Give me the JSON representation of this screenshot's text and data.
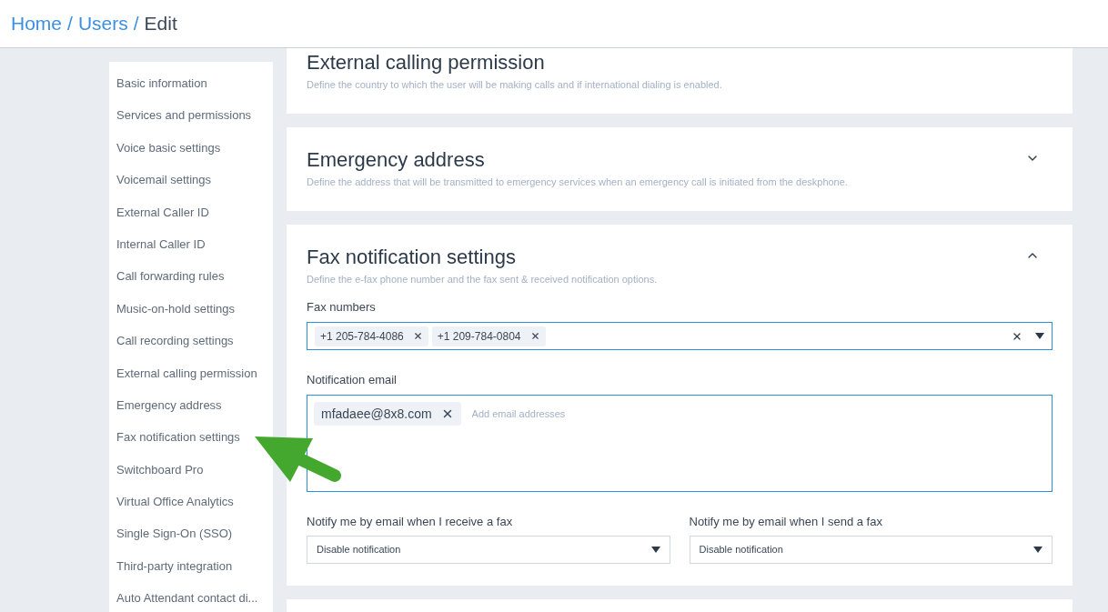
{
  "breadcrumb": [
    {
      "label": "Home",
      "kind": "link"
    },
    {
      "label": "/",
      "kind": "separator"
    },
    {
      "label": "Users",
      "kind": "link"
    },
    {
      "label": "/",
      "kind": "separator"
    },
    {
      "label": "Edit",
      "kind": "current"
    }
  ],
  "sidebar": {
    "items": [
      {
        "label": "Basic information"
      },
      {
        "label": "Services and permissions"
      },
      {
        "label": "Voice basic settings"
      },
      {
        "label": "Voicemail settings"
      },
      {
        "label": "External Caller ID"
      },
      {
        "label": "Internal Caller ID"
      },
      {
        "label": "Call forwarding rules"
      },
      {
        "label": "Music-on-hold settings"
      },
      {
        "label": "Call recording settings"
      },
      {
        "label": "External calling permission"
      },
      {
        "label": "Emergency address"
      },
      {
        "label": "Fax notification settings"
      },
      {
        "label": "Switchboard Pro"
      },
      {
        "label": "Virtual Office Analytics"
      },
      {
        "label": "Single Sign-On (SSO)"
      },
      {
        "label": "Third-party integration"
      },
      {
        "label": "Auto Attendant contact di..."
      }
    ]
  },
  "sections": [
    {
      "title": "External calling permission",
      "description": "Define the country to which the user will be making calls and if international dialing is enabled."
    },
    {
      "title": "Emergency address",
      "description": "Define the address that will be transmitted to emergency services when an emergency call is initiated from the deskphone.",
      "expanded": false
    },
    {
      "title": "Fax notification settings",
      "description": "Define the e-fax phone number and the fax sent & received notification options.",
      "expanded": true,
      "fax_numbers": {
        "label": "Fax numbers",
        "chips": [
          "+1 205-784-4086",
          "+1 209-784-0804"
        ]
      },
      "notification_email": {
        "label": "Notification email",
        "chips": [
          "mfadaee@8x8.com"
        ],
        "placeholder": "Add email addresses"
      },
      "selects": [
        {
          "label": "Notify me by email when I receive a fax",
          "value": "Disable notification"
        },
        {
          "label": "Notify me by email when I send a fax",
          "value": "Disable notification"
        }
      ]
    }
  ]
}
